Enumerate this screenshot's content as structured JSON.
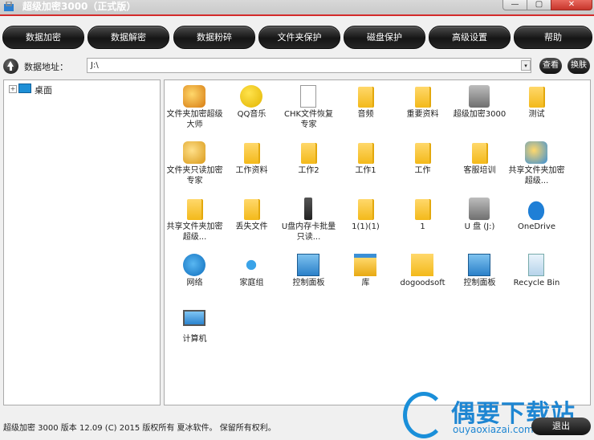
{
  "window": {
    "title": "超级加密3000（正式版）",
    "min_glyph": "—",
    "max_glyph": "▢",
    "close_glyph": "✕"
  },
  "toolbar": {
    "buttons": [
      "数据加密",
      "数据解密",
      "数据粉碎",
      "文件夹保护",
      "磁盘保护",
      "高级设置",
      "帮助"
    ]
  },
  "address": {
    "label": "数据地址：",
    "value": "J:\\",
    "view_label": "查看",
    "switch_label": "换肤"
  },
  "tree": {
    "toggle": "+",
    "root_label": "桌面"
  },
  "items": [
    {
      "label": "文件夹加密超级大师",
      "icon": "app-folder-lock-icon"
    },
    {
      "label": "QQ音乐",
      "icon": "qq-music-icon"
    },
    {
      "label": "CHK文件恢复专家",
      "icon": "chk-document-icon"
    },
    {
      "label": "音频",
      "icon": "folder-icon"
    },
    {
      "label": "重要资料",
      "icon": "folder-icon"
    },
    {
      "label": "超级加密3000",
      "icon": "app-drive-icon"
    },
    {
      "label": "测试",
      "icon": "folder-icon"
    },
    {
      "label": "文件夹只读加密专家",
      "icon": "app-folder-readonly-icon"
    },
    {
      "label": "工作资料",
      "icon": "folder-icon"
    },
    {
      "label": "工作2",
      "icon": "folder-icon"
    },
    {
      "label": "工作1",
      "icon": "folder-icon"
    },
    {
      "label": "工作",
      "icon": "folder-icon"
    },
    {
      "label": "客服培训",
      "icon": "folder-icon"
    },
    {
      "label": "共享文件夹加密超级...",
      "icon": "app-shared-folder-icon"
    },
    {
      "label": "共享文件夹加密超级...",
      "icon": "folder-icon"
    },
    {
      "label": "丢失文件",
      "icon": "folder-icon"
    },
    {
      "label": "U盘内存卡批量只读...",
      "icon": "usb-app-icon"
    },
    {
      "label": "1(1)(1)",
      "icon": "folder-icon"
    },
    {
      "label": "1",
      "icon": "folder-icon"
    },
    {
      "label": "U 盘 (J:)",
      "icon": "usb-drive-icon"
    },
    {
      "label": "OneDrive",
      "icon": "onedrive-cloud-icon"
    },
    {
      "label": "网络",
      "icon": "network-icon"
    },
    {
      "label": "家庭组",
      "icon": "homegroup-icon"
    },
    {
      "label": "控制面板",
      "icon": "control-panel-icon"
    },
    {
      "label": "库",
      "icon": "library-icon"
    },
    {
      "label": "dogoodsoft",
      "icon": "user-folder-icon"
    },
    {
      "label": "控制面板",
      "icon": "control-panel-icon"
    },
    {
      "label": "Recycle Bin",
      "icon": "recycle-bin-icon"
    },
    {
      "label": "计算机",
      "icon": "computer-icon"
    }
  ],
  "status": {
    "text": "超级加密 3000  版本 12.09 (C) 2015 版权所有 夏冰软件。 保留所有权利。",
    "exit_label": "退出"
  },
  "watermark": {
    "title": "偶要下载站",
    "url": "ouyaoxiazai.com"
  }
}
